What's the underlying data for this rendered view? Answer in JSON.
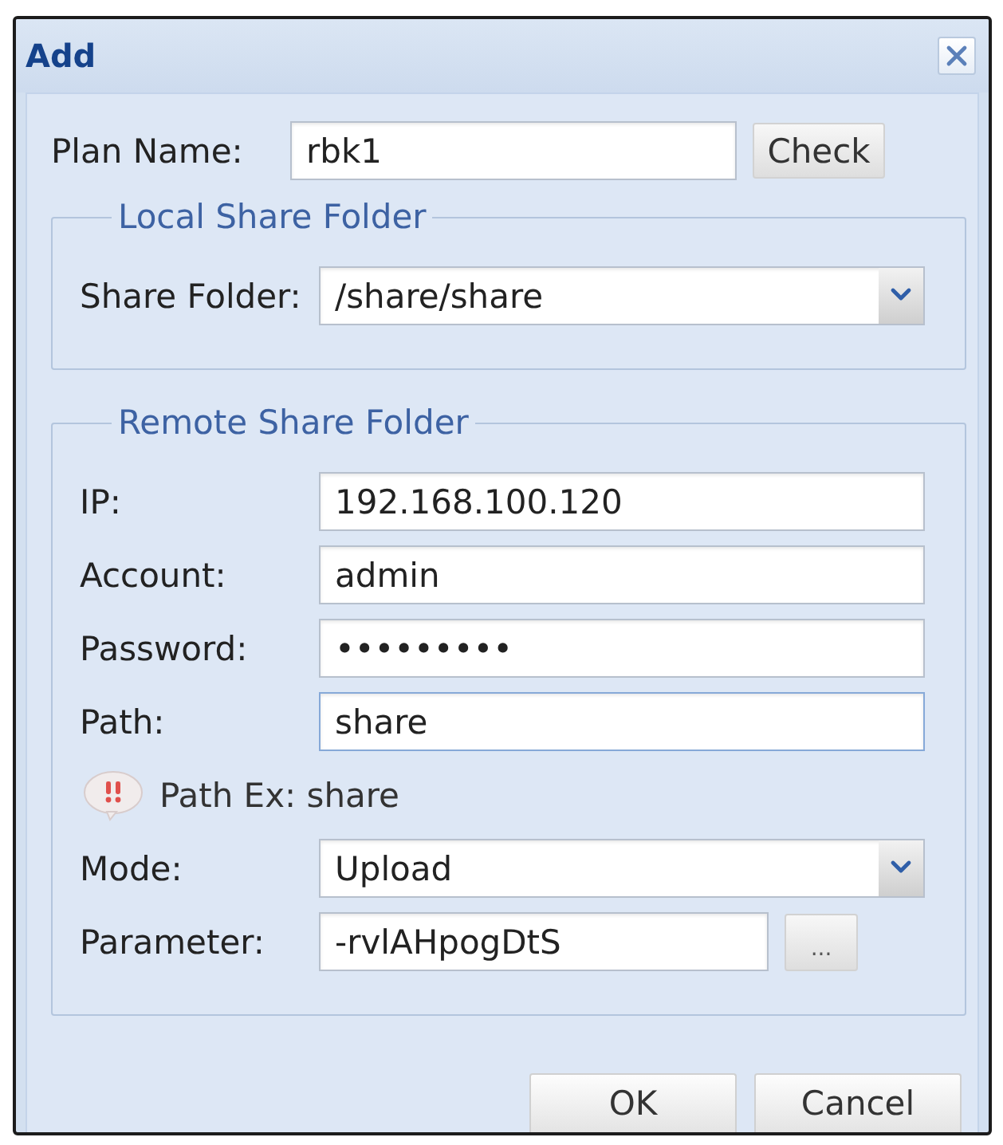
{
  "window": {
    "title": "Add"
  },
  "plan_name": {
    "label": "Plan Name:",
    "value": "rbk1",
    "button": "Check"
  },
  "local_share_folder": {
    "legend": "Local Share Folder",
    "fields": [
      {
        "kind": "select",
        "label": "Share Folder:",
        "value": "/share/share",
        "focused": false
      }
    ]
  },
  "remote_share_folder": {
    "legend": "Remote Share Folder",
    "fields": [
      {
        "kind": "text",
        "label": "IP:",
        "value": "192.168.100.120",
        "focused": false
      },
      {
        "kind": "text",
        "label": "Account:",
        "value": "admin",
        "focused": false
      },
      {
        "kind": "password",
        "label": "Password:",
        "value": "•••••••••",
        "focused": false
      },
      {
        "kind": "text",
        "label": "Path:",
        "value": "share",
        "focused": true
      },
      {
        "kind": "hint",
        "text": "Path Ex: share"
      },
      {
        "kind": "select",
        "label": "Mode:",
        "value": "Upload",
        "focused": false
      },
      {
        "kind": "text_button",
        "label": "Parameter:",
        "value": "-rvlAHpogDtS",
        "button": "...",
        "focused": false
      }
    ]
  },
  "buttons": [
    "OK",
    "Cancel"
  ]
}
